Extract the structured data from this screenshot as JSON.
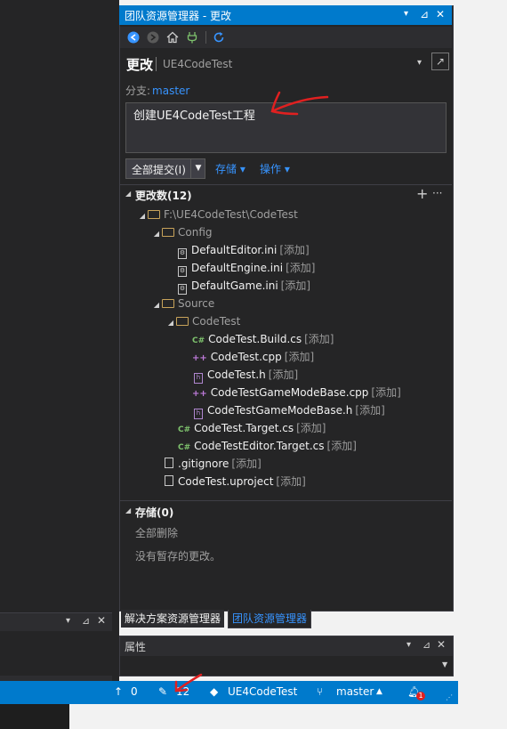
{
  "window": {
    "title": "团队资源管理器 - 更改",
    "title_buttons": [
      "▾",
      "⊿",
      "✕"
    ]
  },
  "toolbar": {
    "back_icon": "back-arrow-icon",
    "forward_icon": "forward-arrow-icon",
    "home_icon": "home-icon",
    "connect_icon": "plug-icon",
    "refresh_icon": "refresh-icon"
  },
  "page": {
    "title": "更改",
    "repo": "UE4CodeTest"
  },
  "branch": {
    "label": "分支:",
    "name": "master"
  },
  "commit": {
    "message": "创建UE4CodeTest工程",
    "button_label": "全部提交(I)",
    "stash_label": "存储 ▾",
    "actions_label": "操作 ▾"
  },
  "changes": {
    "header": "更改数(12)",
    "root_path": "F:\\UE4CodeTest\\CodeTest",
    "config_folder": "Config",
    "source_folder": "Source",
    "codetest_folder": "CodeTest",
    "status_add": "[添加]",
    "files": [
      {
        "name": "DefaultEditor.ini",
        "status": "[添加]"
      },
      {
        "name": "DefaultEngine.ini",
        "status": "[添加]"
      },
      {
        "name": "DefaultGame.ini",
        "status": "[添加]"
      },
      {
        "name": "CodeTest.Build.cs",
        "status": "[添加]"
      },
      {
        "name": "CodeTest.cpp",
        "status": "[添加]"
      },
      {
        "name": "CodeTest.h",
        "status": "[添加]"
      },
      {
        "name": "CodeTestGameModeBase.cpp",
        "status": "[添加]"
      },
      {
        "name": "CodeTestGameModeBase.h",
        "status": "[添加]"
      },
      {
        "name": "CodeTest.Target.cs",
        "status": "[添加]"
      },
      {
        "name": "CodeTestEditor.Target.cs",
        "status": "[添加]"
      },
      {
        "name": ".gitignore",
        "status": "[添加]"
      },
      {
        "name": "CodeTest.uproject",
        "status": "[添加]"
      }
    ]
  },
  "stash": {
    "header": "存储(0)",
    "delete_all": "全部删除",
    "empty_message": "没有暂存的更改。"
  },
  "tabs": [
    {
      "label": "解决方案资源管理器"
    },
    {
      "label": "团队资源管理器"
    }
  ],
  "properties": {
    "title": "属性"
  },
  "statusbar": {
    "push_count": "0",
    "pending_count": "12",
    "repo": "UE4CodeTest",
    "branch": "master",
    "notifications": "1"
  },
  "colors": {
    "accent": "#007acc",
    "link": "#3794ff",
    "annotation_red": "#e02020"
  }
}
